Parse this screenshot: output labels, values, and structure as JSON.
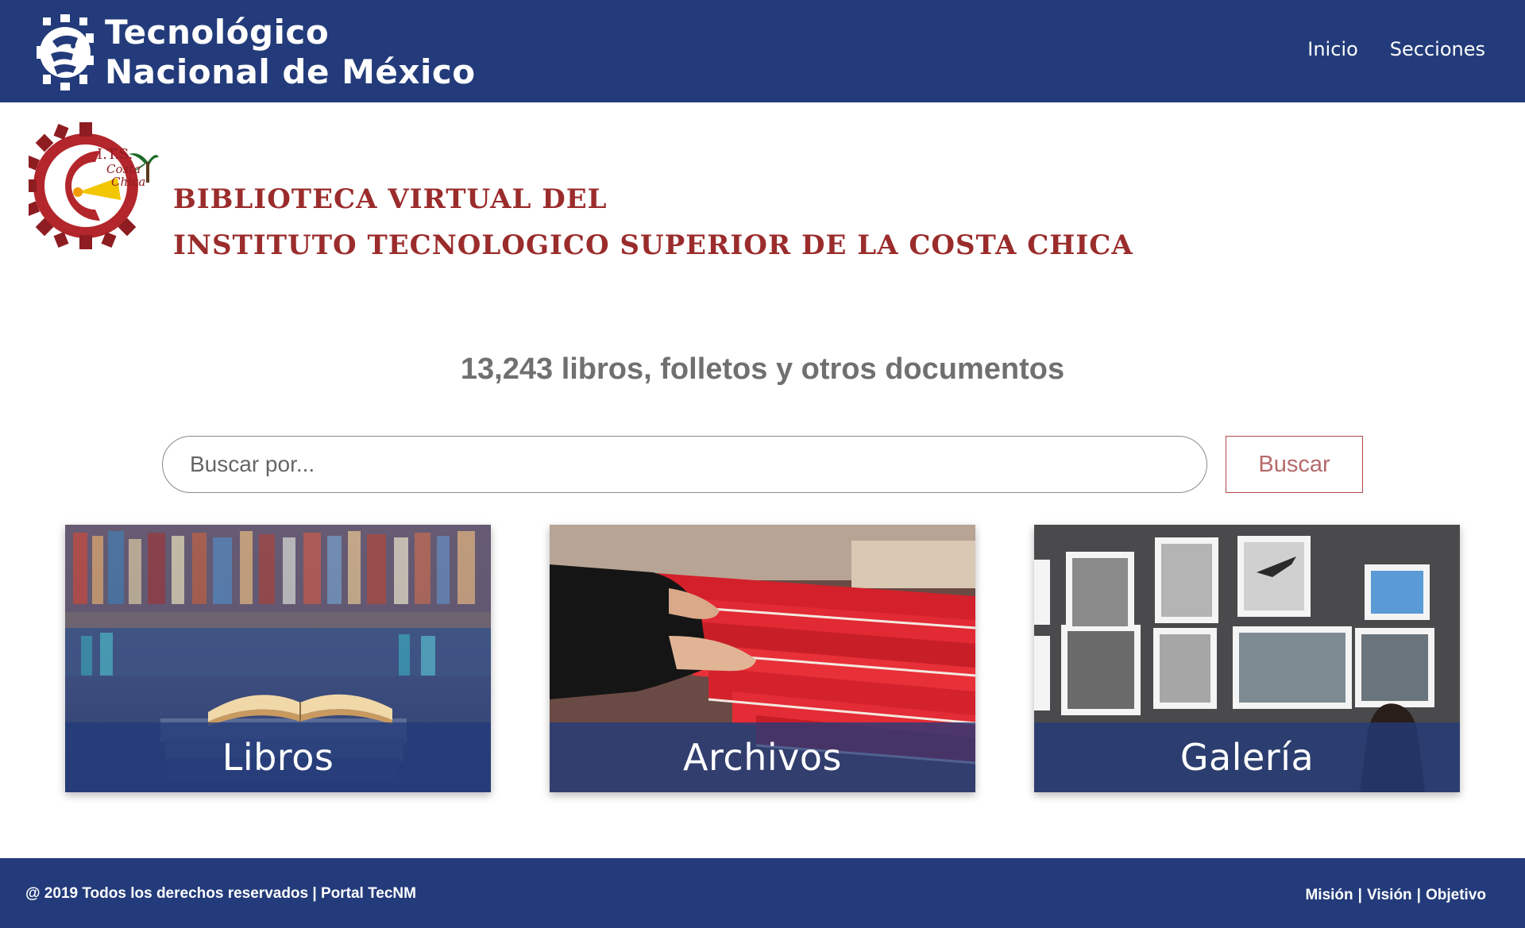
{
  "header": {
    "brand_line1": "Tecnológico",
    "brand_line2": "Nacional de México",
    "logo_icon": "tecnm-eagle-gear-logo",
    "nav": [
      {
        "label": "Inicio"
      },
      {
        "label": "Secciones"
      }
    ]
  },
  "institute": {
    "logo_icon": "its-costa-chica-gear-logo",
    "logo_text_top": "I.T.S.",
    "logo_text_mid": "Costa",
    "logo_text_bottom": "Chica",
    "title_line1": "BIBLIOTECA VIRTUAL DEL",
    "title_line2": "INSTITUTO TECNOLOGICO SUPERIOR DE LA COSTA CHICA"
  },
  "stats": {
    "text": "13,243 libros, folletos y otros documentos"
  },
  "search": {
    "placeholder": "Buscar por...",
    "value": "",
    "button_label": "Buscar"
  },
  "cards": [
    {
      "label": "Libros",
      "image": "open-book-library-image"
    },
    {
      "label": "Archivos",
      "image": "hands-filing-folders-image"
    },
    {
      "label": "Galería",
      "image": "photo-gallery-wall-image"
    }
  ],
  "footer": {
    "copyright": "@ 2019 Todos los derechos reservados | Portal TecNM",
    "links": [
      {
        "label": "Misión"
      },
      {
        "label": "Visión"
      },
      {
        "label": "Objetivo"
      }
    ],
    "separator": "|"
  },
  "colors": {
    "brand_navy": "#233b7a",
    "title_red": "#9b2c2c",
    "stats_gray": "#707070",
    "button_red": "#b24a4a"
  }
}
